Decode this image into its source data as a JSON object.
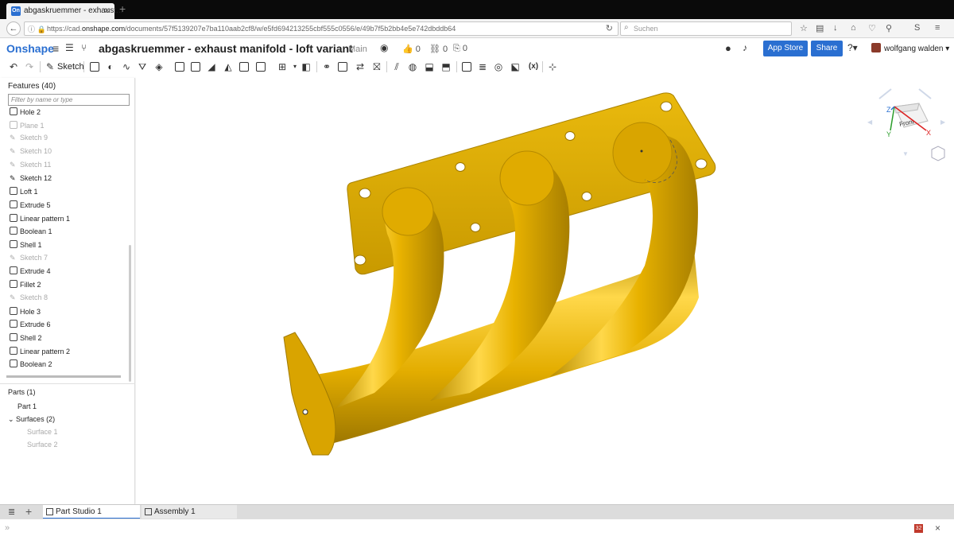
{
  "browser": {
    "tab_title": "abgaskruemmer - exhaust...",
    "favicon_text": "On",
    "url_prefix": "https://cad.",
    "url_domain": "onshape.com",
    "url_path": "/documents/57f5139207e7ba110aab2cf8/w/e5fd694213255cbf555c0556/e/49b7f5b2bb4e5e742dbddb64",
    "search_placeholder": "Suchen"
  },
  "header": {
    "logo": "Onshape",
    "document_title": "abgaskruemmer - exhaust manifold - loft variant",
    "workspace": "Main",
    "likes": "0",
    "links": "0",
    "copies": "0",
    "app_store": "App Store",
    "share": "Share",
    "user": "wolfgang walden"
  },
  "toolbar": {
    "sketch_label": "Sketch",
    "variable_label": "(x)"
  },
  "features": {
    "title": "Features (40)",
    "filter_placeholder": "Filter by name or type",
    "items": [
      {
        "label": "Hole 2",
        "dim": false,
        "icon": "hole-icon"
      },
      {
        "label": "Plane 1",
        "dim": true,
        "icon": "plane-icon"
      },
      {
        "label": "Sketch 9",
        "dim": true,
        "icon": "sketch-icon"
      },
      {
        "label": "Sketch 10",
        "dim": true,
        "icon": "sketch-icon"
      },
      {
        "label": "Sketch 11",
        "dim": true,
        "icon": "sketch-icon"
      },
      {
        "label": "Sketch 12",
        "dim": false,
        "icon": "sketch-icon"
      },
      {
        "label": "Loft 1",
        "dim": false,
        "icon": "loft-icon"
      },
      {
        "label": "Extrude 5",
        "dim": false,
        "icon": "extrude-icon"
      },
      {
        "label": "Linear pattern 1",
        "dim": false,
        "icon": "linear-pattern-icon"
      },
      {
        "label": "Boolean 1",
        "dim": false,
        "icon": "boolean-icon"
      },
      {
        "label": "Shell 1",
        "dim": false,
        "icon": "shell-icon"
      },
      {
        "label": "Sketch 7",
        "dim": true,
        "icon": "sketch-icon"
      },
      {
        "label": "Extrude 4",
        "dim": false,
        "icon": "extrude-icon"
      },
      {
        "label": "Fillet 2",
        "dim": false,
        "icon": "fillet-icon"
      },
      {
        "label": "Sketch 8",
        "dim": true,
        "icon": "sketch-icon"
      },
      {
        "label": "Hole 3",
        "dim": false,
        "icon": "hole-icon"
      },
      {
        "label": "Extrude 6",
        "dim": false,
        "icon": "extrude-icon"
      },
      {
        "label": "Shell 2",
        "dim": false,
        "icon": "shell-icon"
      },
      {
        "label": "Linear pattern 2",
        "dim": false,
        "icon": "linear-pattern-icon"
      },
      {
        "label": "Boolean 2",
        "dim": false,
        "icon": "boolean-icon"
      }
    ]
  },
  "parts": {
    "title": "Parts (1)",
    "part1": "Part 1",
    "surfaces": "Surfaces (2)",
    "surface1": "Surface 1",
    "surface2": "Surface 2"
  },
  "viewcube": {
    "face_label": "Front",
    "axis_x": "X",
    "axis_y": "Y",
    "axis_z": "Z"
  },
  "bottom_tabs": {
    "tab1": "Part Studio 1",
    "tab2": "Assembly 1"
  },
  "status": {
    "badge": "32"
  },
  "colors": {
    "accent": "#2a6fd1",
    "model": "#e8b200"
  }
}
